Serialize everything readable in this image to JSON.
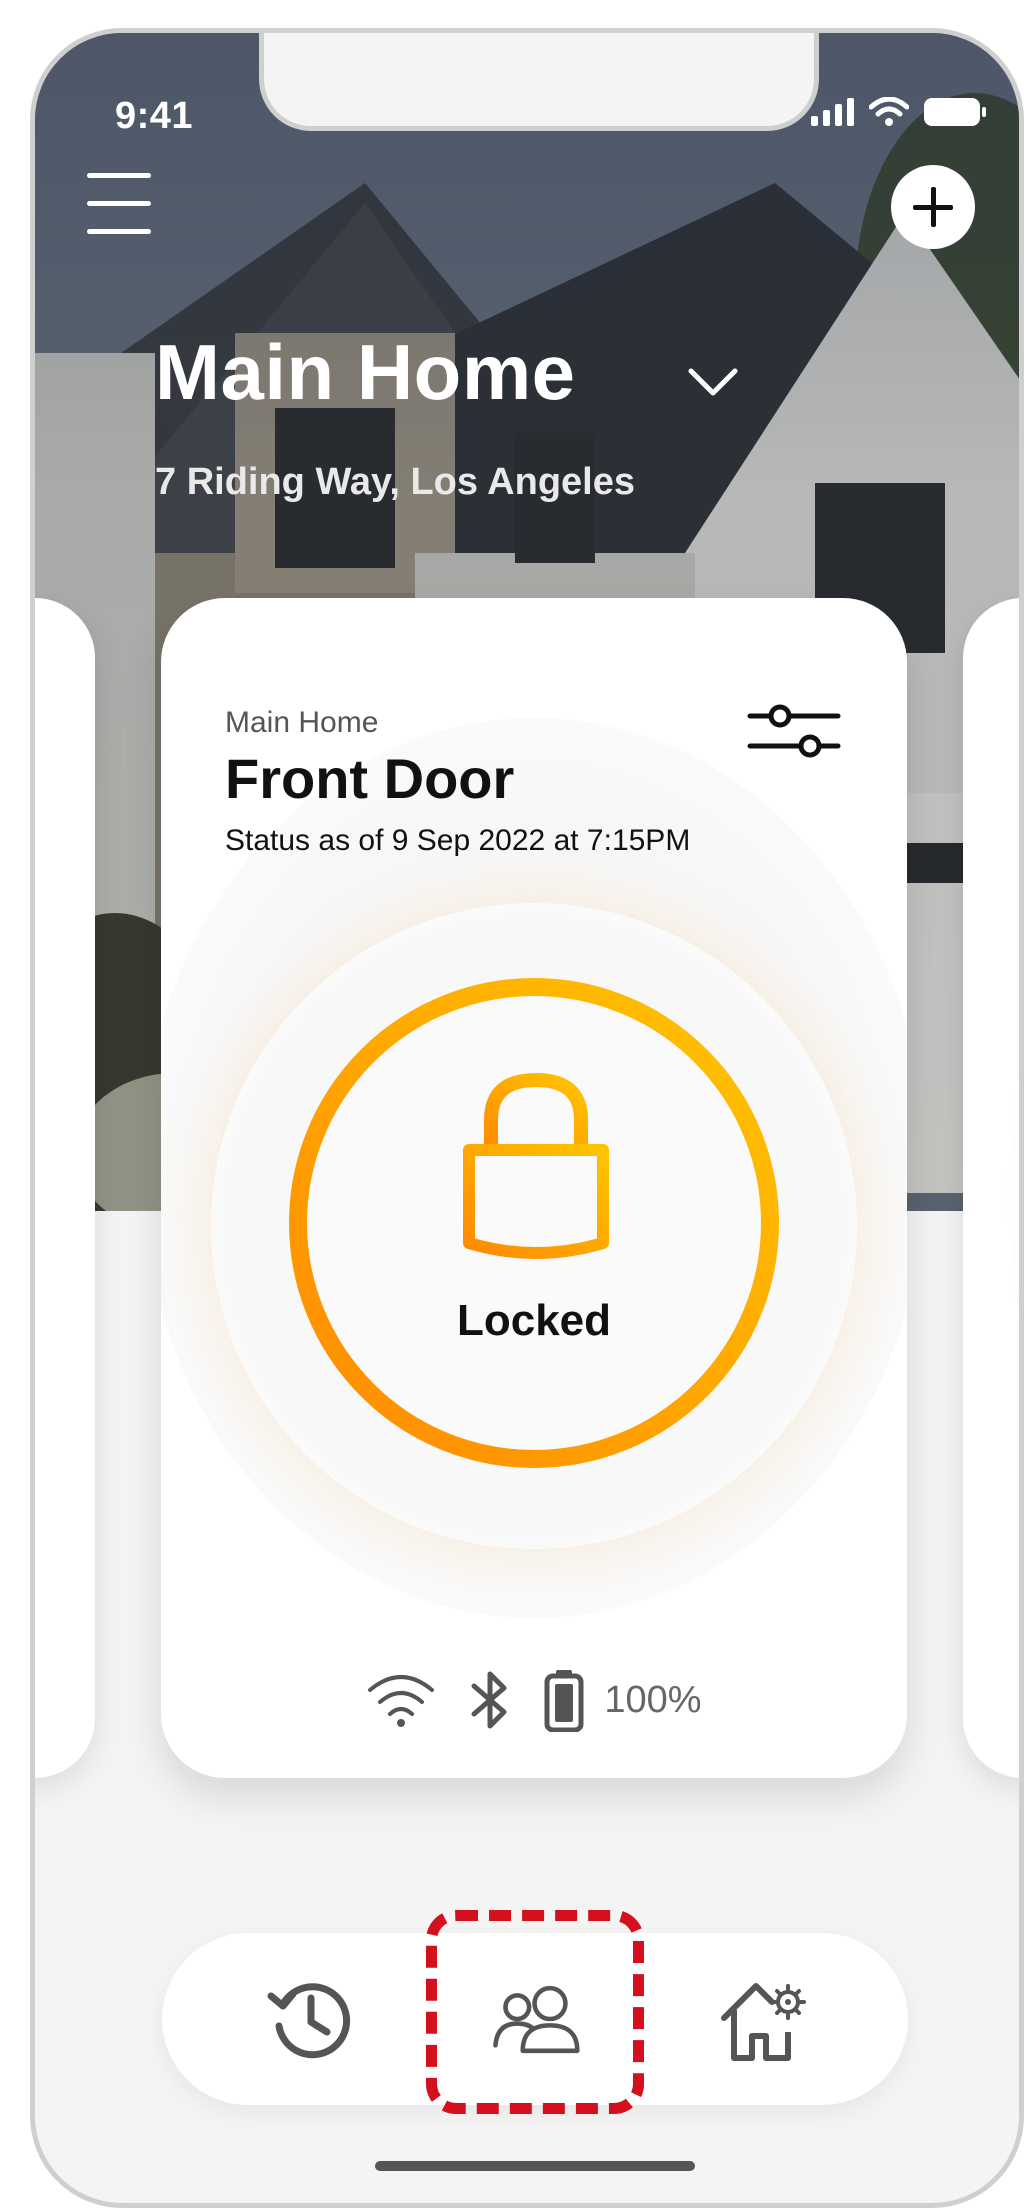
{
  "status_bar": {
    "time": "9:41"
  },
  "header": {
    "home_name": "Main Home",
    "address": "7 Riding Way, Los Angeles",
    "menu_icon": "hamburger-icon",
    "add_icon": "plus-icon"
  },
  "lock_card": {
    "home_label": "Main Home",
    "door_name": "Front Door",
    "status_text": "Status as of 9 Sep 2022 at 7:15PM",
    "lock_state": "Locked",
    "battery_percent": "100%",
    "accent_color": "#ff9d00"
  },
  "bottom_nav": {
    "items": [
      {
        "icon": "history-icon"
      },
      {
        "icon": "users-icon"
      },
      {
        "icon": "home-settings-icon"
      }
    ],
    "highlight_color": "#d40f1e"
  }
}
